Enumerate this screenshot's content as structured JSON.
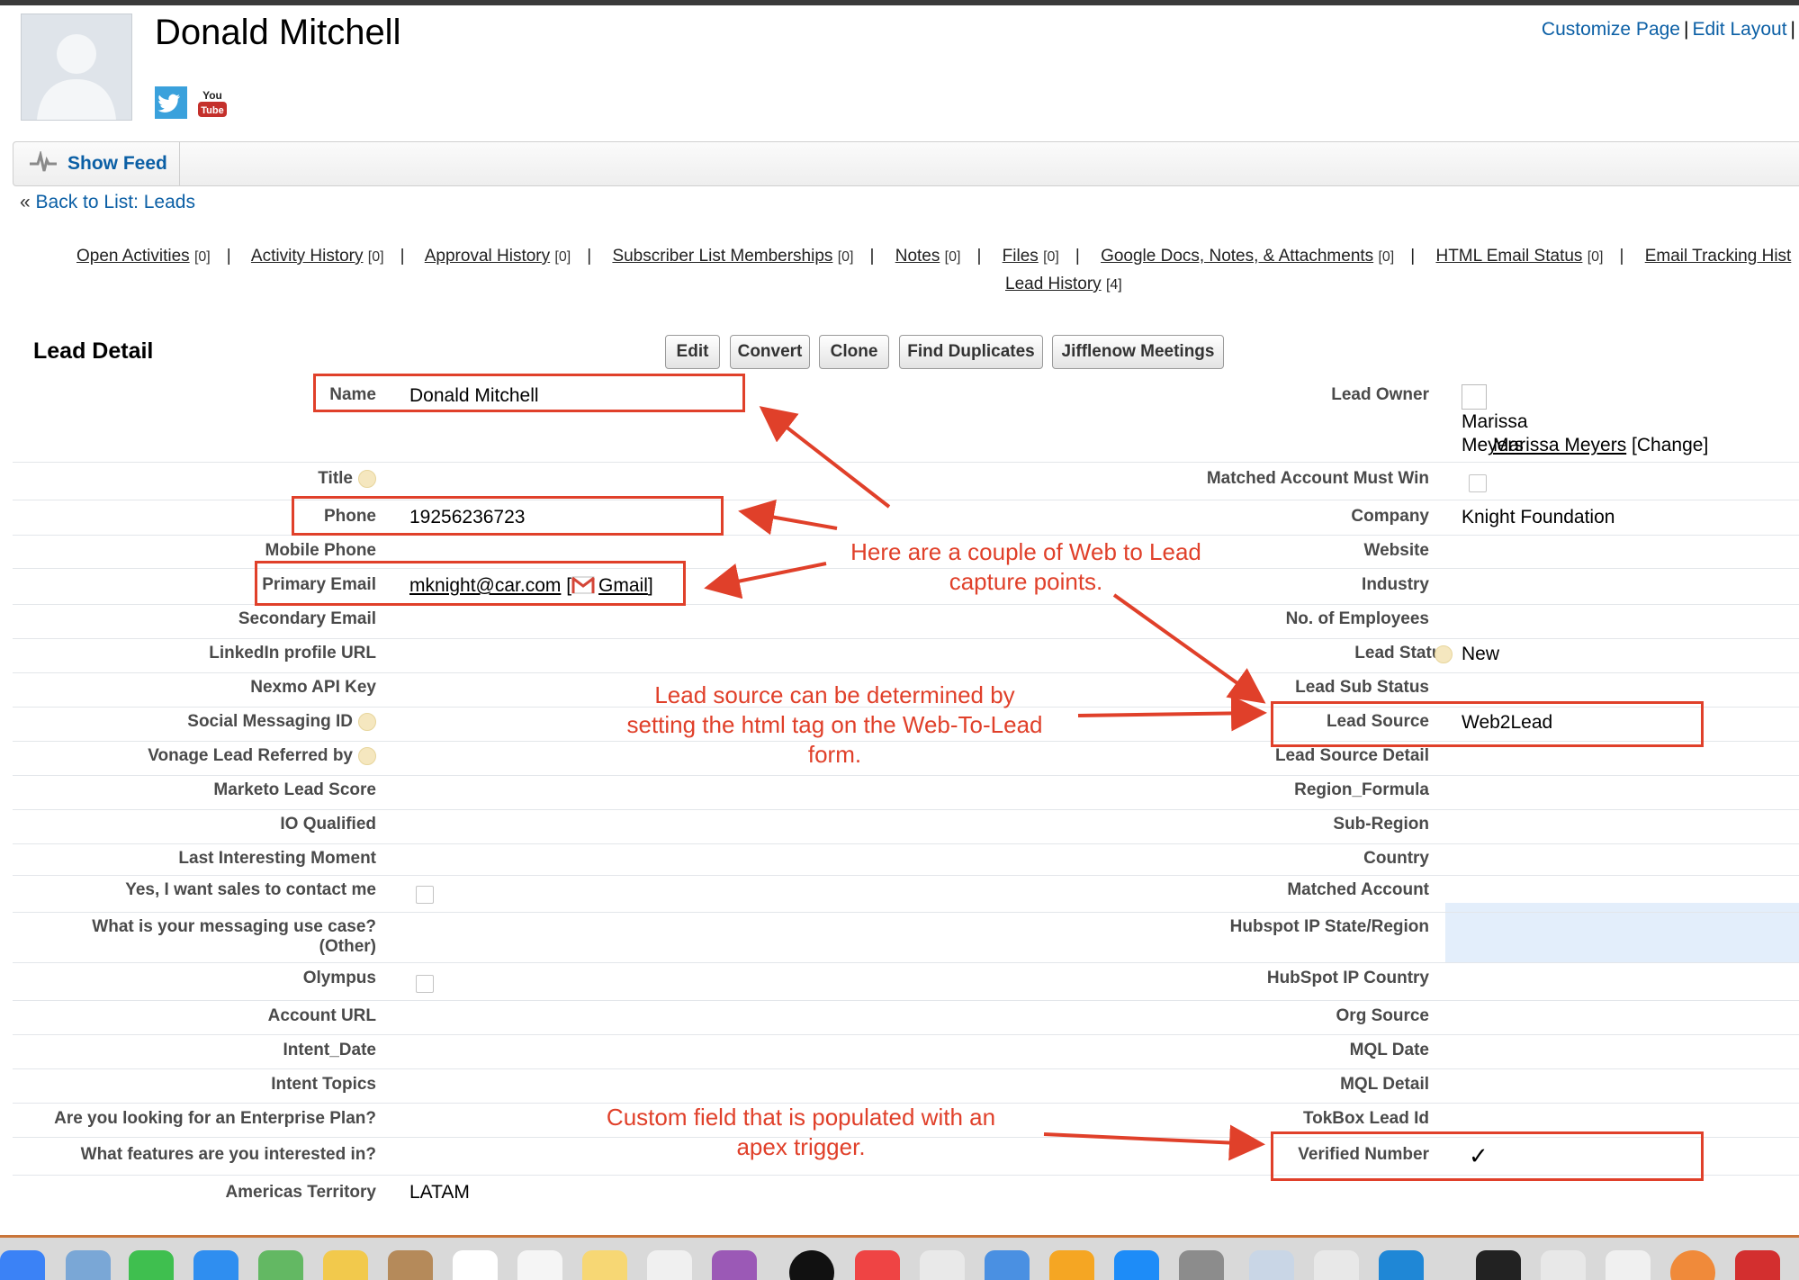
{
  "header": {
    "lead_name": "Donald Mitchell",
    "top_links": [
      "Customize Page",
      "Edit Layout",
      "|"
    ]
  },
  "feed": {
    "show_feed_label": "Show Feed"
  },
  "back": {
    "prefix": "«",
    "link": "Back to List: Leads"
  },
  "related_lists": [
    {
      "label": "Open Activities",
      "count": "[0]"
    },
    {
      "label": "Activity History",
      "count": "[0]"
    },
    {
      "label": "Approval History",
      "count": "[0]"
    },
    {
      "label": "Subscriber List Memberships",
      "count": "[0]"
    },
    {
      "label": "Notes",
      "count": "[0]"
    },
    {
      "label": "Files",
      "count": "[0]"
    },
    {
      "label": "Google Docs, Notes, & Attachments",
      "count": "[0]"
    },
    {
      "label": "HTML Email Status",
      "count": "[0]"
    },
    {
      "label": "Email Tracking Hist",
      "count": ""
    },
    {
      "label": "Lead History",
      "count": "[4]"
    }
  ],
  "detail": {
    "section_title": "Lead Detail",
    "buttons": [
      "Edit",
      "Convert",
      "Clone",
      "Find Duplicates",
      "Jifflenow Meetings"
    ],
    "left_fields": [
      {
        "label": "Name",
        "value": "Donald Mitchell"
      },
      {
        "label": "Title",
        "value": ""
      },
      {
        "label": "Phone",
        "value": "19256236723"
      },
      {
        "label": "Mobile Phone",
        "value": ""
      },
      {
        "label": "Primary Email",
        "value": "mknight@car.com",
        "gmail": "Gmail"
      },
      {
        "label": "Secondary Email",
        "value": ""
      },
      {
        "label": "LinkedIn profile URL",
        "value": ""
      },
      {
        "label": "Nexmo API Key",
        "value": ""
      },
      {
        "label": "Social Messaging ID",
        "value": ""
      },
      {
        "label": "Vonage Lead Referred by",
        "value": ""
      },
      {
        "label": "Marketo Lead Score",
        "value": ""
      },
      {
        "label": "IO Qualified",
        "value": ""
      },
      {
        "label": "Last Interesting Moment",
        "value": ""
      },
      {
        "label": "Yes, I want sales to contact me",
        "value": ""
      },
      {
        "label": "What is your messaging use case?",
        "label2": "(Other)",
        "value": ""
      },
      {
        "label": "Olympus",
        "value": ""
      },
      {
        "label": "Account URL",
        "value": ""
      },
      {
        "label": "Intent_Date",
        "value": ""
      },
      {
        "label": "Intent Topics",
        "value": ""
      },
      {
        "label": "Are you looking for an Enterprise Plan?",
        "value": ""
      },
      {
        "label": "What features are you interested in?",
        "value": ""
      },
      {
        "label": "Americas Territory",
        "value": "LATAM"
      }
    ],
    "right_fields": [
      {
        "label": "Lead Owner",
        "value": "Marissa Meyers",
        "alt1": "Marissa",
        "alt2": "Meyers",
        "change": "[Change]"
      },
      {
        "label": "Matched Account Must Win",
        "value": ""
      },
      {
        "label": "Company",
        "value": "Knight Foundation"
      },
      {
        "label": "Website",
        "value": ""
      },
      {
        "label": "Industry",
        "value": ""
      },
      {
        "label": "No. of Employees",
        "value": ""
      },
      {
        "label": "Lead Status",
        "value": "New"
      },
      {
        "label": "Lead Sub Status",
        "value": ""
      },
      {
        "label": "Lead Source",
        "value": "Web2Lead"
      },
      {
        "label": "Lead Source Detail",
        "value": ""
      },
      {
        "label": "Region_Formula",
        "value": ""
      },
      {
        "label": "Sub-Region",
        "value": ""
      },
      {
        "label": "Country",
        "value": ""
      },
      {
        "label": "Matched Account",
        "value": ""
      },
      {
        "label": "Hubspot IP State/Region",
        "value": ""
      },
      {
        "label": "HubSpot IP Country",
        "value": ""
      },
      {
        "label": "Org Source",
        "value": ""
      },
      {
        "label": "MQL Date",
        "value": ""
      },
      {
        "label": "MQL Detail",
        "value": ""
      },
      {
        "label": "TokBox Lead Id",
        "value": ""
      },
      {
        "label": "Verified Number",
        "value": "✓"
      }
    ]
  },
  "annotations": {
    "note1": [
      "Here are a couple of Web to Lead",
      "capture points."
    ],
    "note2": [
      "Lead source can be determined by",
      "setting the html tag on the Web-To-Lead",
      "form."
    ],
    "note3": [
      "Custom field that is populated with an",
      "apex trigger."
    ],
    "color": "#e0402a"
  },
  "icons": [
    "twitter-icon",
    "youtube-icon",
    "feed-pulse-icon",
    "help-icon",
    "gmail-icon",
    "checkmark-icon"
  ],
  "colors": {
    "link": "#0b5fa5",
    "annotation": "#e0402a",
    "highlight": "#e3eefb"
  }
}
